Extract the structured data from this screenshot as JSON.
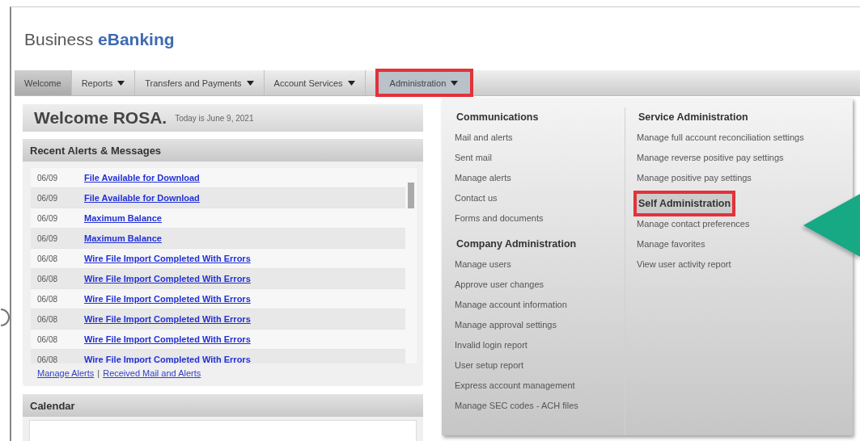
{
  "brand": {
    "plain": "Business",
    "accent": "eBanking"
  },
  "nav": [
    {
      "label": "Welcome",
      "selected": true,
      "caret": false,
      "highlighted": false
    },
    {
      "label": "Reports",
      "selected": false,
      "caret": true,
      "highlighted": false
    },
    {
      "label": "Transfers and Payments",
      "selected": false,
      "caret": true,
      "highlighted": false
    },
    {
      "label": "Account Services",
      "selected": false,
      "caret": true,
      "highlighted": false
    },
    {
      "label": "Administration",
      "selected": false,
      "caret": true,
      "highlighted": true
    }
  ],
  "welcome": {
    "greeting": "Welcome ROSA.",
    "date": "Today is June 9, 2021"
  },
  "alerts": {
    "title": "Recent Alerts & Messages",
    "rows": [
      {
        "date": "06/09",
        "message": "File Available for Download"
      },
      {
        "date": "06/09",
        "message": "File Available for Download"
      },
      {
        "date": "06/09",
        "message": "Maximum Balance"
      },
      {
        "date": "06/09",
        "message": "Maximum Balance"
      },
      {
        "date": "06/08",
        "message": "Wire File Import Completed With Errors"
      },
      {
        "date": "06/08",
        "message": "Wire File Import Completed With Errors"
      },
      {
        "date": "06/08",
        "message": "Wire File Import Completed With Errors"
      },
      {
        "date": "06/08",
        "message": "Wire File Import Completed With Errors"
      },
      {
        "date": "06/08",
        "message": "Wire File Import Completed With Errors"
      },
      {
        "date": "06/08",
        "message": "Wire File Import Completed With Errors"
      }
    ],
    "links": [
      "Manage Alerts",
      "Received Mail and Alerts"
    ],
    "separator": "|"
  },
  "calendar": {
    "title": "Calendar"
  },
  "menu": {
    "columns": [
      [
        {
          "heading": "Communications",
          "highlighted": false,
          "items": [
            "Mail and alerts",
            "Sent mail",
            "Manage alerts",
            "Contact us",
            "Forms and documents"
          ]
        },
        {
          "heading": "Company Administration",
          "highlighted": false,
          "items": [
            "Manage users",
            "Approve user changes",
            "Manage account information",
            "Manage approval settings",
            "Invalid login report",
            "User setup report",
            "Express account management",
            "Manage SEC codes - ACH files"
          ]
        }
      ],
      [
        {
          "heading": "Service Administration",
          "highlighted": false,
          "items": [
            "Manage full account reconciliation settings",
            "Manage reverse positive pay settings",
            "Manage positive pay settings"
          ]
        },
        {
          "heading": "Self Administration",
          "highlighted": true,
          "items": [
            "Manage contact preferences",
            "Manage favorites",
            "View user activity report"
          ]
        }
      ]
    ]
  }
}
